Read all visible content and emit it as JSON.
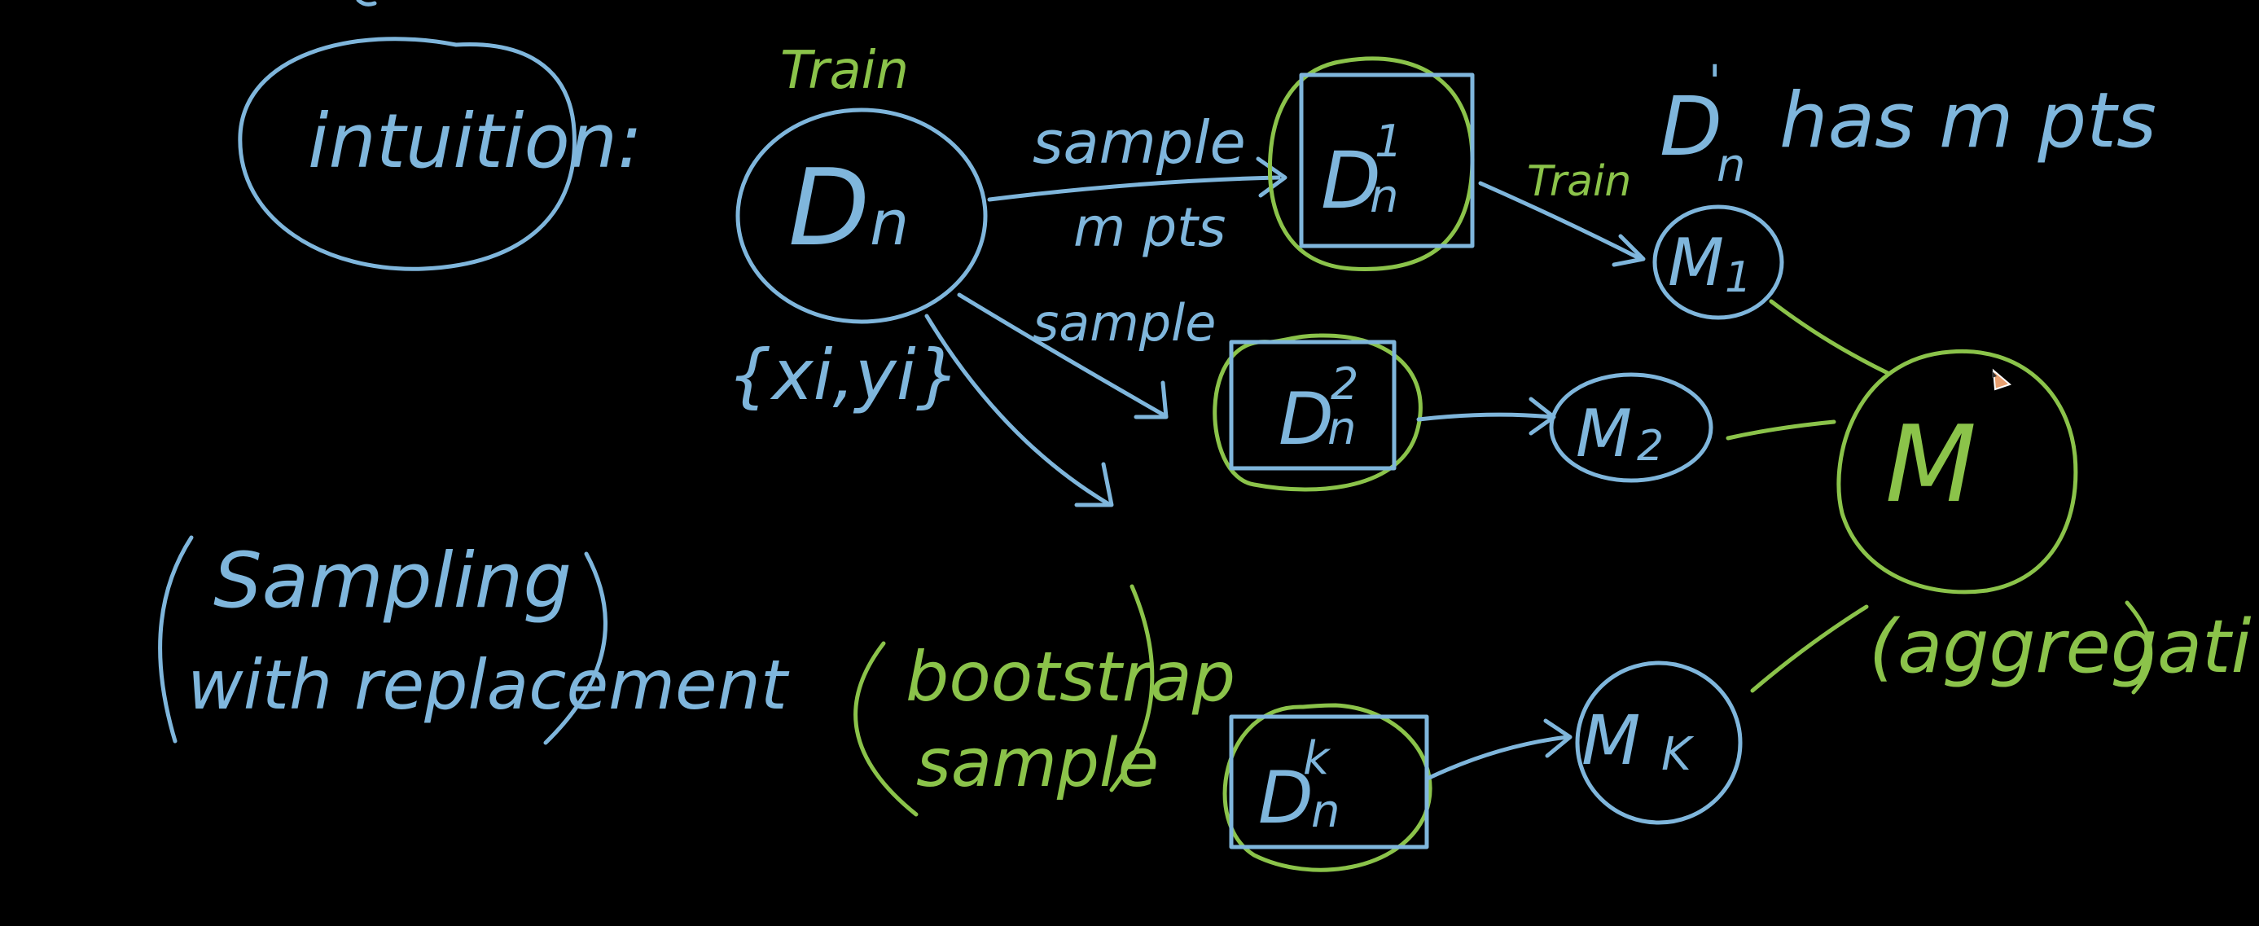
{
  "labels": {
    "intuition": "intuition:",
    "dataset": "D",
    "dataset_sub": "n",
    "train_top": "Train",
    "train_small": "Train",
    "samples_set": "{xi,yi}",
    "sample_1": "sample",
    "m_pts": "m pts",
    "sample_2": "sample",
    "d1": "D",
    "d1_sup": "1",
    "d1_sub": "n",
    "d2": "D",
    "d2_sup": "2",
    "d2_sub": "n",
    "dk": "D",
    "dk_sup": "k",
    "dk_sub": "n",
    "note_head": "D",
    "note_sup": "'",
    "note_sub": "n",
    "note_tail": "has m pts",
    "m1": "M",
    "m1_sub": "1",
    "m2": "M",
    "m2_sub": "2",
    "mk": "M",
    "mk_sub": "K",
    "M": "M",
    "aggregation": "(aggregati",
    "sampling_line1": "Sampling",
    "sampling_line2": "with replacement",
    "bootstrap_line1": "bootstrap",
    "bootstrap_line2": "sample"
  },
  "colors": {
    "background": "#000000",
    "blue_ink": "#7fb6dc",
    "green_ink": "#8bc34a"
  },
  "icons": {
    "pencil_cursor": "pencil-cursor-icon"
  }
}
